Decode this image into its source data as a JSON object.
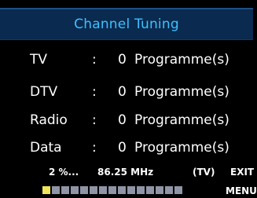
{
  "header": {
    "title": "Channel Tuning"
  },
  "rows": [
    {
      "label": "TV",
      "colon": ":",
      "count": "0",
      "unit": "Programme(s)"
    },
    {
      "label": "DTV",
      "colon": ":",
      "count": "0",
      "unit": "Programme(s)"
    },
    {
      "label": "Radio",
      "colon": ":",
      "count": "0",
      "unit": "Programme(s)"
    },
    {
      "label": "Data",
      "colon": ":",
      "count": "0",
      "unit": "Programme(s)"
    }
  ],
  "status": {
    "percent": "2 %...",
    "frequency": "86.25 MHz",
    "band": "(TV)",
    "exit_label": "EXIT",
    "menu_label": "MENU"
  },
  "progress": {
    "segments_total": 15,
    "segments_filled": 1,
    "fill_color": "#f1e35a",
    "empty_color": "#8f95a6"
  },
  "colors": {
    "title_bar": "#0a2a4f",
    "title_text": "#3fc0ff",
    "background": "#000000"
  }
}
